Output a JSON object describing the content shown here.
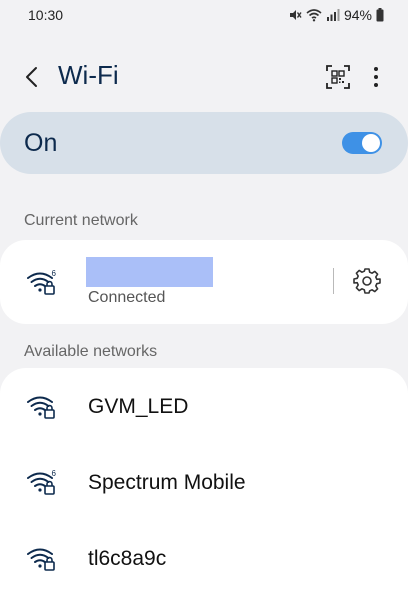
{
  "status_bar": {
    "time": "10:30",
    "battery": "94%"
  },
  "header": {
    "title": "Wi-Fi"
  },
  "wifi_toggle": {
    "label": "On",
    "state": "on"
  },
  "sections": {
    "current": "Current network",
    "available": "Available networks"
  },
  "current_network": {
    "status": "Connected",
    "wifi_standard": "6"
  },
  "available_networks": [
    {
      "name": "GVM_LED",
      "wifi_standard": ""
    },
    {
      "name": "Spectrum Mobile",
      "wifi_standard": "6"
    },
    {
      "name": "tl6c8a9c",
      "wifi_standard": ""
    }
  ],
  "colors": {
    "accent": "#3e91e6",
    "title": "#0d2a4d",
    "toggle_bar": "#d7e0e9",
    "redaction": "#aabff8"
  },
  "icons": [
    "back-arrow-icon",
    "qr-code-icon",
    "more-options-icon",
    "wifi-lock-icon",
    "gear-icon"
  ]
}
